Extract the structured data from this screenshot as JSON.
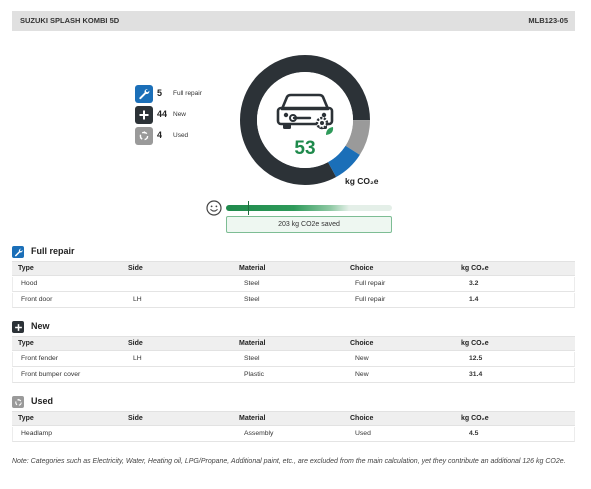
{
  "header": {
    "title": "SUZUKI SPLASH KOMBI 5D",
    "code": "MLB123-05"
  },
  "legend": [
    {
      "icon": "wrench-icon",
      "count": "5",
      "label": "Full repair",
      "color": "#1b6fb8"
    },
    {
      "icon": "plus-icon",
      "count": "44",
      "label": "New",
      "color": "#2c3237"
    },
    {
      "icon": "recycle-icon",
      "count": "4",
      "label": "Used",
      "color": "#9a9a9a"
    }
  ],
  "donut": {
    "value": "53",
    "unit": "kg CO₂e",
    "segments": [
      {
        "name": "New",
        "share": 0.83,
        "color": "#2c3237"
      },
      {
        "name": "Used",
        "share": 0.09,
        "color": "#9a9a9a"
      },
      {
        "name": "Full repair",
        "share": 0.08,
        "color": "#1b6fb8"
      }
    ],
    "value_color": "#1f8a4c"
  },
  "savings": {
    "label": "203 kg CO2e saved",
    "fill_fraction": 0.74,
    "marker_fraction": 0.13
  },
  "columns": {
    "type": "Type",
    "side": "Side",
    "material": "Material",
    "choice": "Choice",
    "kg": "kg CO₂e"
  },
  "sections": [
    {
      "title": "Full repair",
      "icon": "wrench-icon",
      "rows": [
        {
          "type": "Hood",
          "side": "",
          "material": "Steel",
          "choice": "Full repair",
          "kg": "3.2"
        },
        {
          "type": "Front door",
          "side": "LH",
          "material": "Steel",
          "choice": "Full repair",
          "kg": "1.4"
        }
      ]
    },
    {
      "title": "New",
      "icon": "plus-icon",
      "rows": [
        {
          "type": "Front fender",
          "side": "LH",
          "material": "Steel",
          "choice": "New",
          "kg": "12.5"
        },
        {
          "type": "Front bumper cover",
          "side": "",
          "material": "Plastic",
          "choice": "New",
          "kg": "31.4"
        }
      ]
    },
    {
      "title": "Used",
      "icon": "recycle-icon",
      "rows": [
        {
          "type": "Headlamp",
          "side": "",
          "material": "Assembly",
          "choice": "Used",
          "kg": "4.5"
        }
      ]
    }
  ],
  "note": "Note: Categories such as Electricity, Water, Heating oil, LPG/Propane, Additional paint, etc., are excluded from the main calculation, yet they contribute an additional 126 kg CO2e."
}
